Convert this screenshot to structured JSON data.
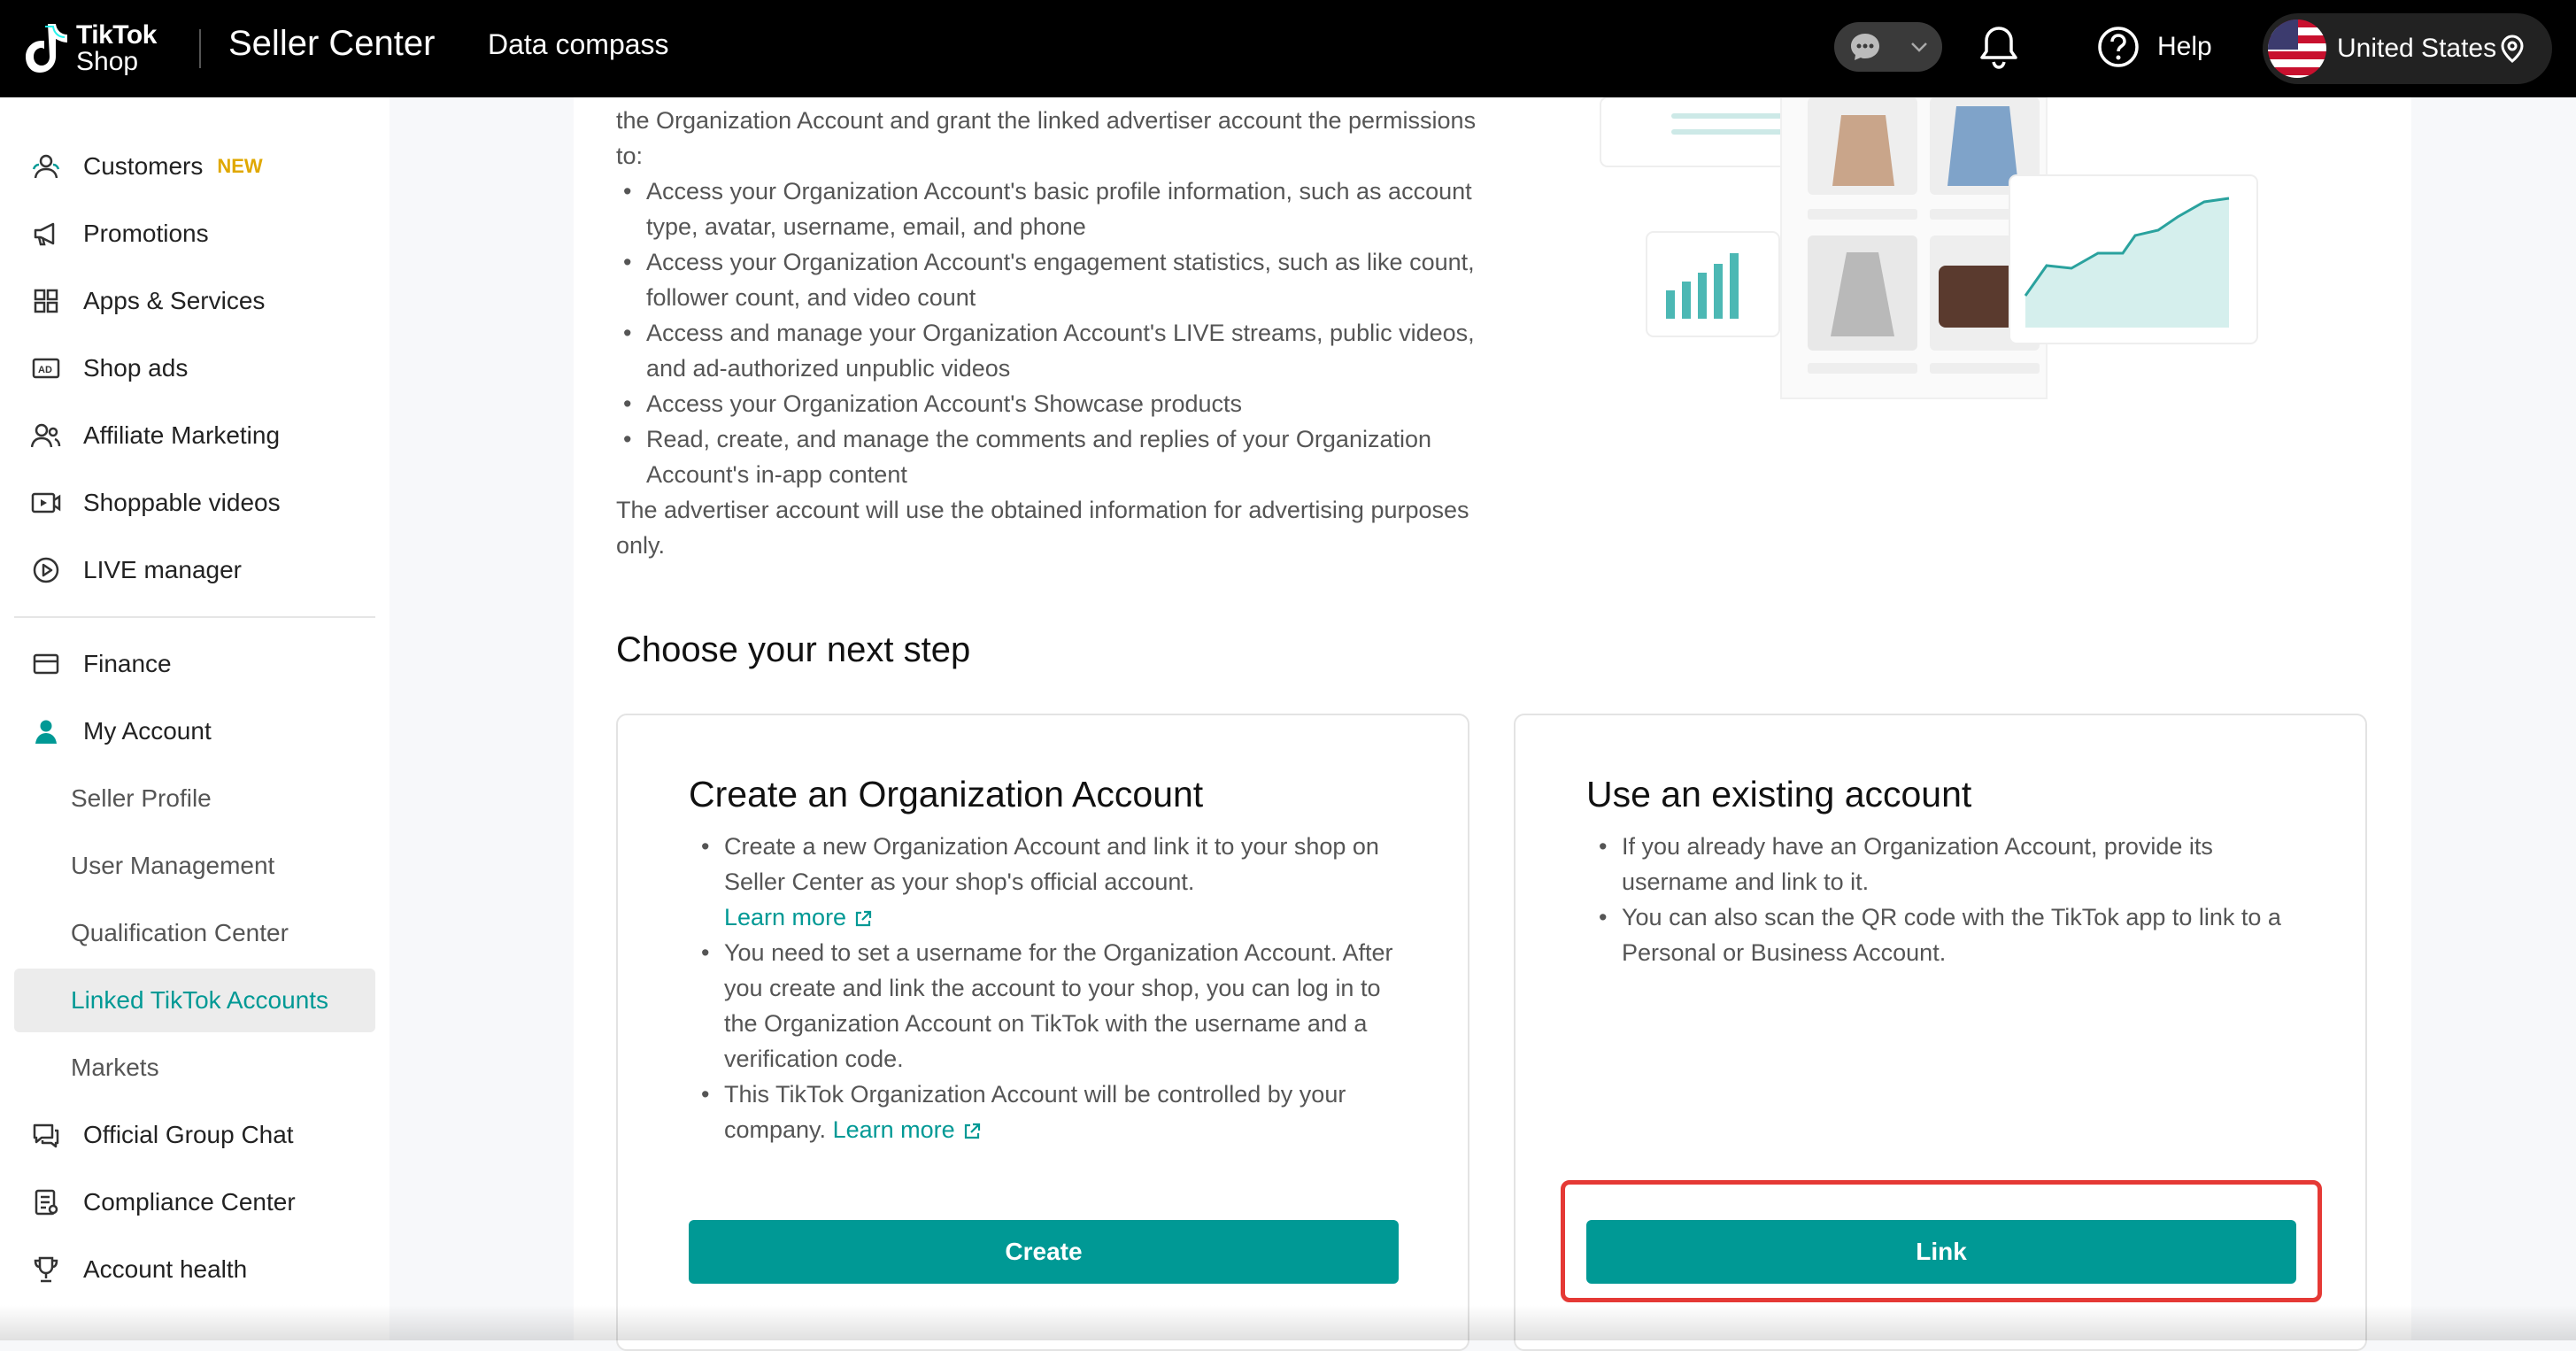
{
  "topbar": {
    "logo_line1": "TikTok",
    "logo_line2": "Shop",
    "brand": "Seller Center",
    "data_compass": "Data compass",
    "help": "Help",
    "region": "United States"
  },
  "sidebar": {
    "items": [
      {
        "label": "Customers",
        "badge": "NEW",
        "icon": "customers-icon"
      },
      {
        "label": "Promotions",
        "icon": "megaphone-icon"
      },
      {
        "label": "Apps & Services",
        "icon": "apps-grid-icon"
      },
      {
        "label": "Shop ads",
        "icon": "ad-icon"
      },
      {
        "label": "Affiliate Marketing",
        "icon": "affiliate-icon"
      },
      {
        "label": "Shoppable videos",
        "icon": "video-icon"
      },
      {
        "label": "LIVE manager",
        "icon": "live-icon"
      },
      {
        "label": "Finance",
        "icon": "wallet-icon"
      },
      {
        "label": "My Account",
        "icon": "user-icon"
      },
      {
        "label": "Seller Profile"
      },
      {
        "label": "User Management"
      },
      {
        "label": "Qualification Center"
      },
      {
        "label": "Linked TikTok Accounts",
        "active": true
      },
      {
        "label": "Markets"
      },
      {
        "label": "Official Group Chat",
        "icon": "group-chat-icon"
      },
      {
        "label": "Compliance Center",
        "icon": "compliance-icon"
      },
      {
        "label": "Account health",
        "icon": "trophy-icon"
      }
    ]
  },
  "permissions": {
    "intro": "the Organization Account and grant the linked advertiser account the permissions to:",
    "bullets": [
      "Access your Organization Account's basic profile information, such as account type, avatar, username, email, and phone",
      "Access your Organization Account's engagement statistics, such as like count, follower count, and video count",
      "Access and manage your Organization Account's LIVE streams, public videos, and ad-authorized unpublic videos",
      "Access your Organization Account's Showcase products",
      "Read, create, and manage the comments and replies of your Organization Account's in-app content"
    ],
    "outro": "The advertiser account will use the obtained information for advertising purposes only."
  },
  "next_step_title": "Choose your next step",
  "create_card": {
    "title": "Create an Organization Account",
    "bullet1": "Create a new Organization Account and link it to your shop on Seller Center as your shop's official account.",
    "learn_more": "Learn more",
    "bullet2": "You need to set a username for the Organization Account. After you create and link the account to your shop, you can log in to the Organization Account on TikTok with the username and a verification code.",
    "bullet3": "This TikTok Organization Account will be controlled by your company.",
    "button": "Create"
  },
  "existing_card": {
    "title": "Use an existing account",
    "bullet1": "If you already have an Organization Account, provide its username and link to it.",
    "bullet2": "You can also scan the QR code with the TikTok app to link to a Personal or Business Account.",
    "button": "Link"
  },
  "colors": {
    "accent": "#009995",
    "badge": "#e0a800",
    "highlight": "#e53935"
  }
}
